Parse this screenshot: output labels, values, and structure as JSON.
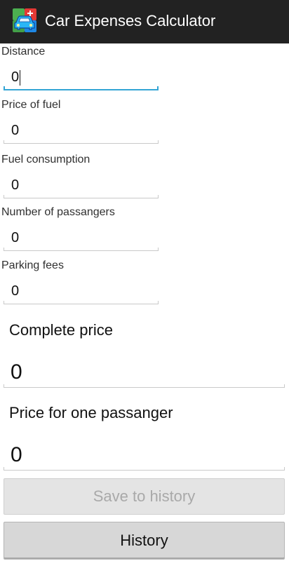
{
  "app": {
    "title": "Car Expenses Calculator",
    "icon": "car-icon",
    "header_color": "#222222"
  },
  "form": {
    "distance": {
      "label": "Distance",
      "value": "0",
      "focused": true
    },
    "fuel_price": {
      "label": "Price of fuel",
      "value": "0"
    },
    "fuel_consumption": {
      "label": "Fuel consumption",
      "value": "0"
    },
    "passengers": {
      "label": "Number of passangers",
      "value": "0"
    },
    "parking_fees": {
      "label": "Parking fees",
      "value": "0"
    }
  },
  "results": {
    "complete_price": {
      "label": "Complete price",
      "value": "0"
    },
    "price_per_passenger": {
      "label": "Price for one passanger",
      "value": "0"
    }
  },
  "buttons": {
    "save_label": "Save to history",
    "save_enabled": false,
    "history_label": "History"
  },
  "colors": {
    "focus_accent": "#33a5d5",
    "divider": "#c9c9c9"
  }
}
